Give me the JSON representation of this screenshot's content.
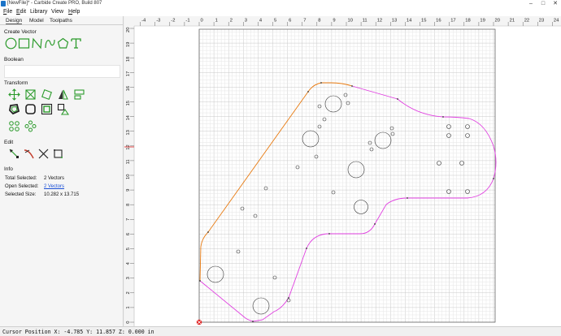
{
  "window": {
    "title": "[NewFile]* - Carbide Create PRO, Build 807",
    "minimize_glyph": "–",
    "maximize_glyph": "□",
    "close_glyph": "✕"
  },
  "menu": [
    {
      "label": "File",
      "u": "F",
      "rest": "ile"
    },
    {
      "label": "Edit",
      "u": "E",
      "rest": "dit"
    },
    {
      "label": "Library",
      "u": "",
      "rest": "Library"
    },
    {
      "label": "View",
      "u": "",
      "rest": "View"
    },
    {
      "label": "Help",
      "u": "H",
      "rest": "elp"
    }
  ],
  "tabs": [
    "Design",
    "Model",
    "Toolpaths"
  ],
  "sections": {
    "create_vector": "Create Vector",
    "boolean": "Boolean",
    "transform": "Transform",
    "edit": "Edit",
    "info": "Info"
  },
  "create_vector_icons": [
    "circle-icon",
    "rectangle-icon",
    "polyline-icon",
    "curve-icon",
    "polygon-icon",
    "text-icon"
  ],
  "info": {
    "total_selected_label": "Total Selected:",
    "total_selected_value": "2 Vectors",
    "open_selected_label": "Open Selected:",
    "open_selected_value": "2 Vectors",
    "selected_size_label": "Selected Size:",
    "selected_size_value": "10.282 x 13.715"
  },
  "status": {
    "cursor_text": "Cursor Position X: -4.785 Y: 11.857 Z: 0.000 in"
  },
  "ruler": {
    "x_ticks": [
      "-4",
      "-3",
      "-2",
      "-1",
      "0",
      "1",
      "2",
      "3",
      "4",
      "5",
      "6",
      "7",
      "8",
      "9",
      "10",
      "11",
      "12",
      "13",
      "14",
      "15",
      "16",
      "17",
      "18",
      "19",
      "20",
      "21",
      "22",
      "23",
      "24"
    ],
    "y_ticks": [
      "0",
      "1",
      "2",
      "3",
      "4",
      "5",
      "6",
      "7",
      "8",
      "9",
      "10",
      "11",
      "12",
      "13",
      "14",
      "15",
      "16",
      "17",
      "18",
      "19",
      "20"
    ],
    "cursor_y_marker": "12"
  },
  "colors": {
    "orange_path": "#e87a10",
    "magenta_path": "#e040e0",
    "accent_green": "#2a9a2a",
    "link_blue": "#1a4fd6"
  }
}
